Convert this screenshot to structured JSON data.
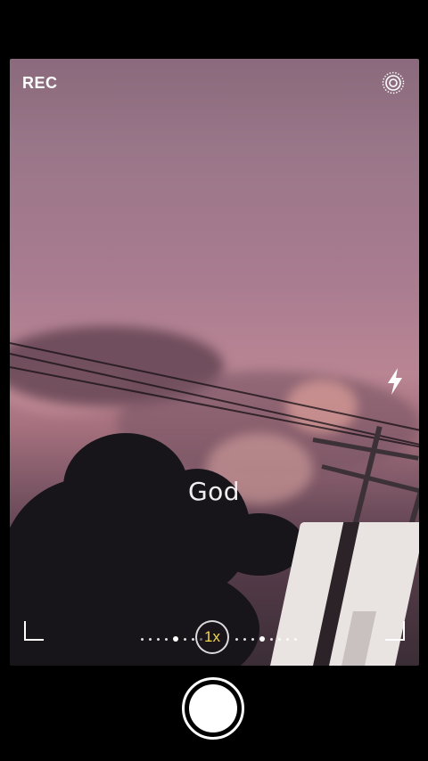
{
  "top": {
    "rec_label": "REC",
    "live_icon": "live-photo-icon"
  },
  "overlay": {
    "caption": "God",
    "flash_icon": "flash-icon"
  },
  "zoom": {
    "label": "1x",
    "label_color": "#f5d84a"
  },
  "controls": {
    "shutter": "shutter-button"
  }
}
